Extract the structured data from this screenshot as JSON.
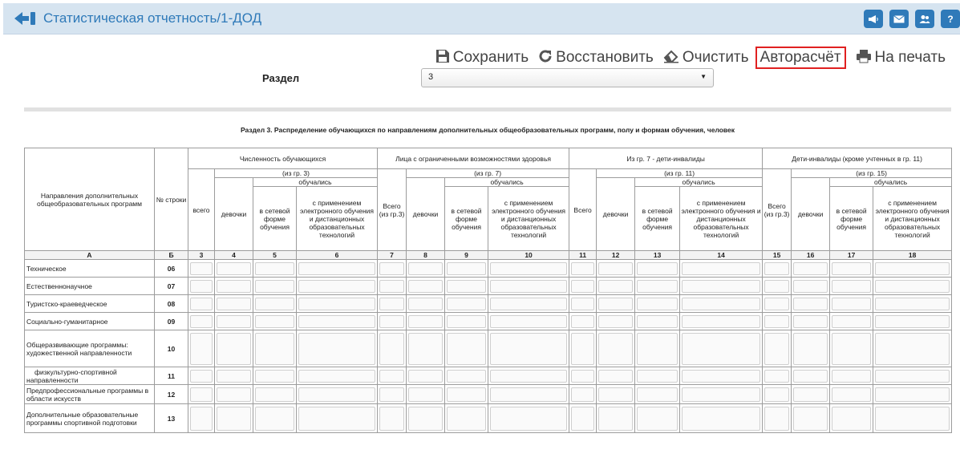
{
  "header": {
    "title": "Статистическая отчетность/1-ДОД",
    "icons": [
      "megaphone-icon",
      "envelope-icon",
      "users-icon",
      "help-icon"
    ],
    "help_label": "?"
  },
  "toolbar": {
    "save": "Сохранить",
    "restore": "Восстановить",
    "clear": "Очистить",
    "autocalc": "Авторасчёт",
    "print": "На печать"
  },
  "section": {
    "label": "Раздел",
    "value": "3"
  },
  "table": {
    "caption": "Раздел 3. Распределение обучающихся по направлениям дополнительных общеобразовательных программ, полу и формам обучения, человек",
    "col_direction": "Направления дополнительных общеобразовательных программ",
    "col_rowno": "№ строки",
    "groups": [
      {
        "title": "Численность обучающихся",
        "sub": "(из гр. 3)",
        "total": "всего"
      },
      {
        "title": "Лица с ограниченными возможностями здоровья",
        "sub": "(из гр. 7)",
        "total": "Всего (из гр.3)"
      },
      {
        "title": "Из гр. 7 - дети-инвалиды",
        "sub": "(из гр. 11)",
        "total": "Всего"
      },
      {
        "title": "Дети-инвалиды (кроме учтенных в гр. 11)",
        "sub": "(из гр. 15)",
        "total": "Всего (из гр.3)"
      }
    ],
    "studied": "обучались",
    "girls": "девочки",
    "network": "в сетевой форме обучения",
    "distance": "с применением электронного обучения и дистанционных образовательных технологий",
    "index_row": [
      "А",
      "Б",
      "3",
      "4",
      "5",
      "6",
      "7",
      "8",
      "9",
      "10",
      "11",
      "12",
      "13",
      "14",
      "15",
      "16",
      "17",
      "18"
    ],
    "rows": [
      {
        "label": "Техническое",
        "no": "06"
      },
      {
        "label": "Естественнонаучное",
        "no": "07"
      },
      {
        "label": "Туристско-краеведческое",
        "no": "08"
      },
      {
        "label": "Социально-гуманитарное",
        "no": "09"
      },
      {
        "label": "Общеразвивающие программы: художественной направленности",
        "no": "10"
      },
      {
        "label": "физкультурно-спортивной направленности",
        "no": "11"
      },
      {
        "label": "Предпрофессиональные программы в области искусств",
        "no": "12"
      },
      {
        "label": "Дополнительные образовательные программы спортивной подготовки",
        "no": "13"
      }
    ]
  }
}
